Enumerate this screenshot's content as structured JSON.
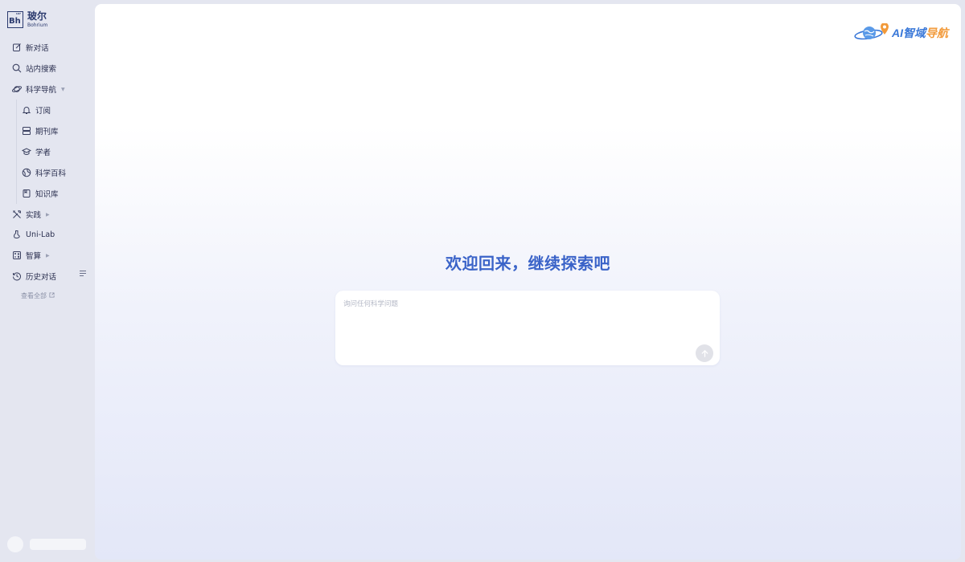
{
  "brand": {
    "name": "玻尔",
    "subtitle": "Bohrium",
    "symbol": "Bh"
  },
  "sidebar": {
    "items": [
      {
        "label": "新对话",
        "icon": "edit-icon"
      },
      {
        "label": "站内搜索",
        "icon": "search-icon"
      },
      {
        "label": "科学导航",
        "icon": "planet-icon"
      },
      {
        "label": "订阅",
        "icon": "bell-icon"
      },
      {
        "label": "期刊库",
        "icon": "database-icon"
      },
      {
        "label": "学者",
        "icon": "graduation-cap-icon"
      },
      {
        "label": "科学百科",
        "icon": "globe-icon"
      },
      {
        "label": "知识库",
        "icon": "book-icon"
      },
      {
        "label": "实践",
        "icon": "tools-icon"
      },
      {
        "label": "Uni-Lab",
        "icon": "flask-icon"
      },
      {
        "label": "智算",
        "icon": "calculator-icon"
      },
      {
        "label": "历史对话",
        "icon": "history-icon"
      }
    ],
    "view_all": "查看全部"
  },
  "main": {
    "corner_logo": {
      "ai": "AI",
      "zhiyu": "智域",
      "daohang": "导航"
    },
    "welcome": "欢迎回来，继续探索吧",
    "chat": {
      "placeholder": "询问任何科学问题",
      "value": ""
    }
  },
  "colors": {
    "accent": "#3a63c8",
    "sidebar_bg": "#e4e6f0",
    "logo_blue": "#3a78d8",
    "logo_orange": "#f29a3a"
  }
}
